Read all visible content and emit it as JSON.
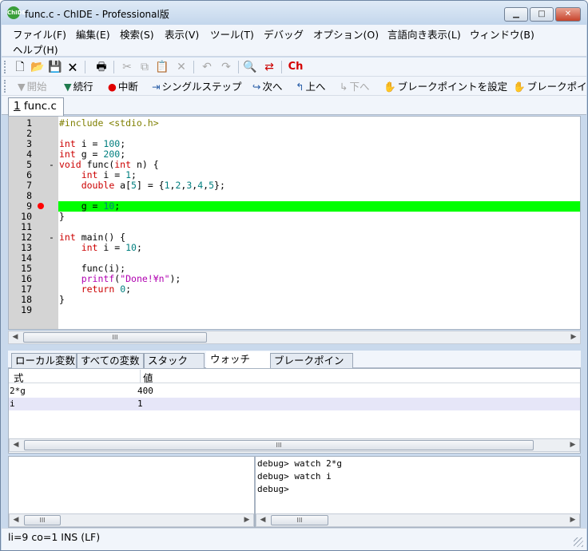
{
  "window": {
    "title": "func.c - ChIDE - Professional版",
    "icon_text": "ChIDE",
    "buttons": {
      "minimize": "▁",
      "maximize": "□",
      "close": "✕"
    }
  },
  "menu": [
    "ファイル(F)",
    "編集(E)",
    "検索(S)",
    "表示(V)",
    "ツール(T)",
    "デバッグ",
    "オプション(O)",
    "言語向き表示(L)",
    "ウィンドウ(B)",
    "ヘルプ(H)"
  ],
  "toolbar": {
    "icons": [
      {
        "name": "new-file-icon",
        "glyph": "🗋",
        "enabled": true
      },
      {
        "name": "open-file-icon",
        "glyph": "📂",
        "enabled": true
      },
      {
        "name": "save-icon",
        "glyph": "💾",
        "enabled": true
      },
      {
        "name": "close-file-icon",
        "glyph": "🗙",
        "enabled": true
      },
      {
        "name": "print-icon",
        "glyph": "🖶",
        "enabled": true
      },
      {
        "name": "cut-icon",
        "glyph": "✂",
        "enabled": false
      },
      {
        "name": "copy-icon",
        "glyph": "⧉",
        "enabled": false
      },
      {
        "name": "paste-icon",
        "glyph": "📋",
        "enabled": false
      },
      {
        "name": "delete-icon",
        "glyph": "✕",
        "enabled": false
      },
      {
        "name": "undo-icon",
        "glyph": "↶",
        "enabled": false
      },
      {
        "name": "redo-icon",
        "glyph": "↷",
        "enabled": false
      },
      {
        "name": "find-icon",
        "glyph": "🔍",
        "enabled": true
      },
      {
        "name": "replace-icon",
        "glyph": "⇄",
        "enabled": true
      },
      {
        "name": "ch-run-icon",
        "glyph": "Ch",
        "enabled": true
      }
    ]
  },
  "debug_toolbar": {
    "start": "開始",
    "continue": "続行",
    "break": "中断",
    "single_step": "シングルステップ",
    "next": "次へ",
    "up": "上へ",
    "down": "下へ",
    "set_breakpoint": "ブレークポイントを設定",
    "clear_breakpoint": "ブレークポイ"
  },
  "file_tab": {
    "index": "1",
    "name": "func.c"
  },
  "editor": {
    "lines": [
      {
        "n": "1",
        "text": "#include <stdio.h>"
      },
      {
        "n": "2",
        "text": ""
      },
      {
        "n": "3",
        "text": "int i = 100;"
      },
      {
        "n": "4",
        "text": "int g = 200;"
      },
      {
        "n": "5",
        "text": "void func(int n) {"
      },
      {
        "n": "6",
        "text": "    int i = 1;"
      },
      {
        "n": "7",
        "text": "    double a[5] = {1,2,3,4,5};"
      },
      {
        "n": "8",
        "text": ""
      },
      {
        "n": "9",
        "text": "    g = 10;"
      },
      {
        "n": "10",
        "text": "}"
      },
      {
        "n": "11",
        "text": ""
      },
      {
        "n": "12",
        "text": "int main() {"
      },
      {
        "n": "13",
        "text": "    int i = 10;"
      },
      {
        "n": "14",
        "text": ""
      },
      {
        "n": "15",
        "text": "    func(i);"
      },
      {
        "n": "16",
        "text": "    printf(\"Done!¥n\");"
      },
      {
        "n": "17",
        "text": "    return 0;"
      },
      {
        "n": "18",
        "text": "}"
      },
      {
        "n": "19",
        "text": ""
      }
    ],
    "breakpoint_line": "9",
    "current_line": "9",
    "highlight_color": "#00ff00"
  },
  "debug_tabs": [
    "ローカル変数",
    "すべての変数",
    "スタック",
    "ウォッチ",
    "ブレークポイント"
  ],
  "active_debug_tab": "ウォッチ",
  "watch": {
    "headers": {
      "expr": "式",
      "value": "値"
    },
    "rows": [
      {
        "expr": "2*g",
        "value": "400"
      },
      {
        "expr": "i",
        "value": "1"
      }
    ]
  },
  "console": {
    "lines": [
      "debug> watch 2*g",
      "debug> watch i",
      "debug>"
    ]
  },
  "scrollbar_thumb": "III",
  "status": "li=9 co=1 INS (LF)"
}
